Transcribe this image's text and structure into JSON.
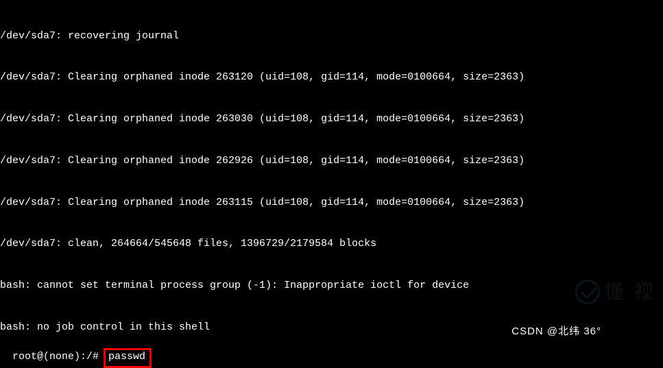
{
  "terminal": {
    "lines": [
      "/dev/sda7: recovering journal",
      "/dev/sda7: Clearing orphaned inode 263120 (uid=108, gid=114, mode=0100664, size=2363)",
      "/dev/sda7: Clearing orphaned inode 263030 (uid=108, gid=114, mode=0100664, size=2363)",
      "/dev/sda7: Clearing orphaned inode 262926 (uid=108, gid=114, mode=0100664, size=2363)",
      "/dev/sda7: Clearing orphaned inode 263115 (uid=108, gid=114, mode=0100664, size=2363)",
      "/dev/sda7: clean, 264664/545648 files, 1396729/2179584 blocks",
      "bash: cannot set terminal process group (-1): Inappropriate ioctl for device",
      "bash: no job control in this shell"
    ],
    "prompt": "root@(none):/# ",
    "command": "passwd"
  },
  "watermark": {
    "text": "懂 视",
    "attribution": "CSDN @北纬  36°"
  }
}
